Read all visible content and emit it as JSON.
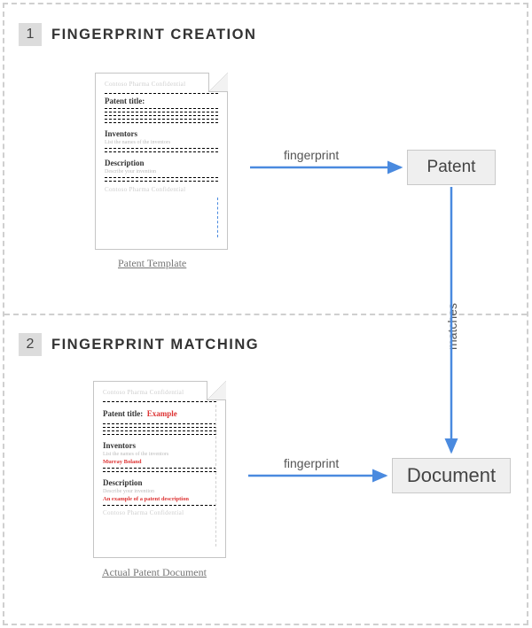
{
  "step1": {
    "badge": "1",
    "title": "FINGERPRINT CREATION",
    "doc": {
      "header": "Contoso Pharma Confidential",
      "title_label": "Patent title:",
      "inventors_label": "Inventors",
      "inventors_sub": "List the names of the inventors",
      "description_label": "Description",
      "description_sub": "Describe your invention",
      "footer": "Contoso Pharma Confidential",
      "caption": "Patent Template"
    },
    "arrow1_label": "fingerprint",
    "node_label": "Patent"
  },
  "vertical_arrow_label": "matches",
  "step2": {
    "badge": "2",
    "title": "FINGERPRINT MATCHING",
    "doc": {
      "header": "Contoso Pharma Confidential",
      "title_label": "Patent title:",
      "title_example": "Example",
      "inventors_label": "Inventors",
      "inventors_sub": "List the names of the inventors",
      "inventors_example": "Murray Boland",
      "description_label": "Description",
      "description_sub": "Describe your invention",
      "description_example": "An example of a patent description",
      "footer": "Contoso Pharma Confidential",
      "caption": "Actual Patent Document"
    },
    "arrow2_label": "fingerprint",
    "node_label": "Document"
  }
}
